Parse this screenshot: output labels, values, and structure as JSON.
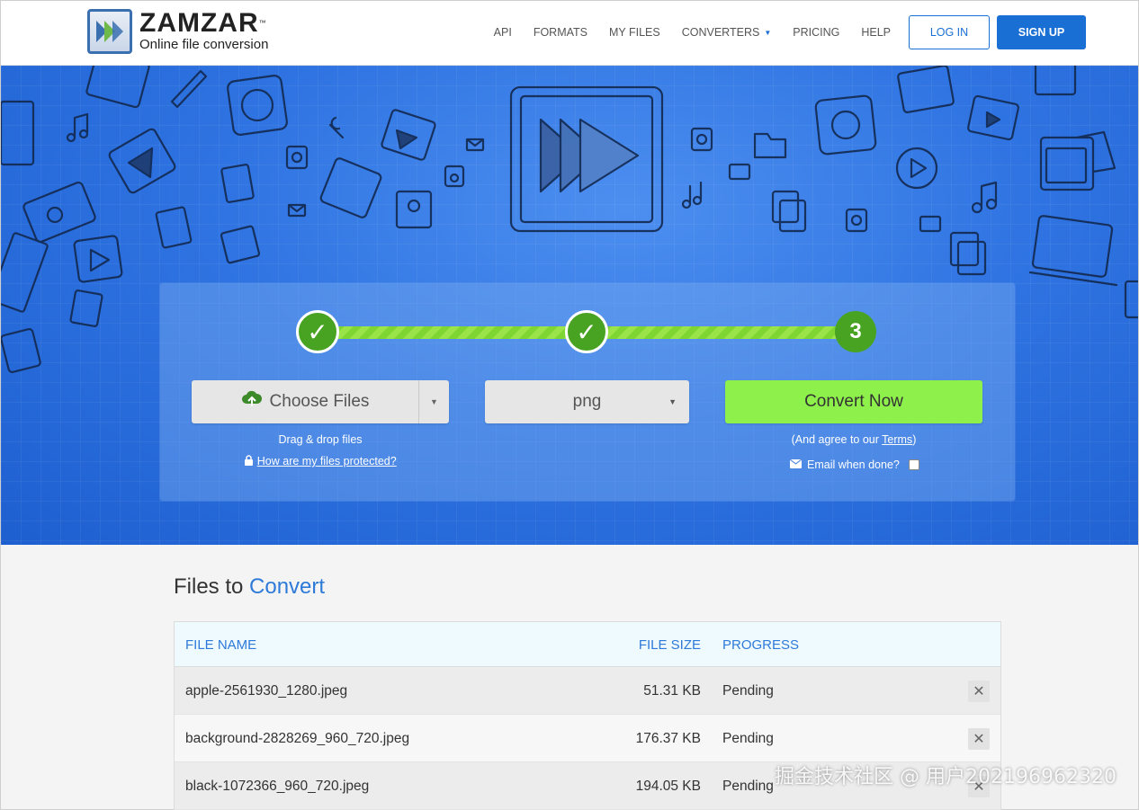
{
  "brand": {
    "name": "ZAMZAR",
    "trademark": "™",
    "tagline": "Online file conversion"
  },
  "nav": {
    "items": [
      {
        "label": "API"
      },
      {
        "label": "FORMATS"
      },
      {
        "label": "MY FILES"
      },
      {
        "label": "CONVERTERS",
        "caret": "▼"
      },
      {
        "label": "PRICING"
      },
      {
        "label": "HELP"
      }
    ],
    "login_label": "LOG IN",
    "signup_label": "SIGN UP"
  },
  "converter": {
    "steps": [
      {
        "state": "done",
        "glyph": "✓"
      },
      {
        "state": "done",
        "glyph": "✓"
      },
      {
        "state": "current",
        "glyph": "3"
      }
    ],
    "choose_files_label": "Choose Files",
    "format_value": "png",
    "convert_label": "Convert Now",
    "drag_drop_text": "Drag & drop files",
    "protected_link": "How are my files protected?",
    "agree_prefix": "(And agree to our ",
    "terms_link": "Terms",
    "agree_suffix": ")",
    "email_label": "Email when done?",
    "email_checked": false
  },
  "files": {
    "title_prefix": "Files to ",
    "title_accent": "Convert",
    "columns": {
      "name": "FILE NAME",
      "size": "FILE SIZE",
      "progress": "PROGRESS"
    },
    "rows": [
      {
        "name": "apple-2561930_1280.jpeg",
        "size": "51.31 KB",
        "progress": "Pending"
      },
      {
        "name": "background-2828269_960_720.jpeg",
        "size": "176.37 KB",
        "progress": "Pending"
      },
      {
        "name": "black-1072366_960_720.jpeg",
        "size": "194.05 KB",
        "progress": "Pending"
      }
    ],
    "remove_glyph": "✕"
  },
  "watermark": "掘金技术社区 @ 用户2021969​62320",
  "colors": {
    "primary": "#1a6fd4",
    "accent_green": "#8ef04a",
    "step_green": "#48a322",
    "hero_blue": "#2f74e2"
  }
}
